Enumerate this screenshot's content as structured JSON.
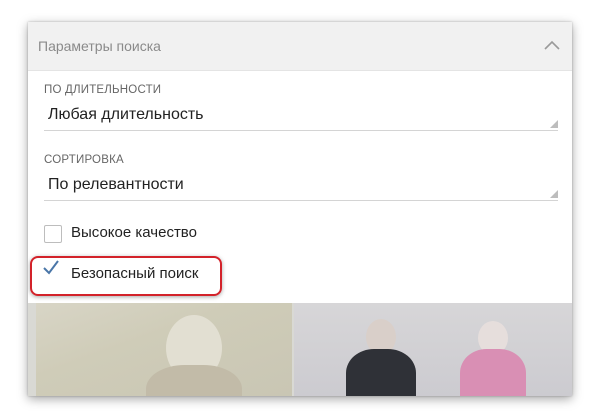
{
  "panel": {
    "title": "Параметры поиска",
    "collapse_icon": "chevron-up-icon"
  },
  "duration": {
    "label": "ПО ДЛИТЕЛЬНОСТИ",
    "value": "Любая длительность"
  },
  "sort": {
    "label": "СОРТИРОВКА",
    "value": "По релевантности"
  },
  "options": [
    {
      "label": "Высокое качество",
      "checked": false
    },
    {
      "label": "Безопасный поиск",
      "checked": true
    }
  ],
  "colors": {
    "highlight": "#d3222a",
    "checkmark": "#4a76a8"
  }
}
